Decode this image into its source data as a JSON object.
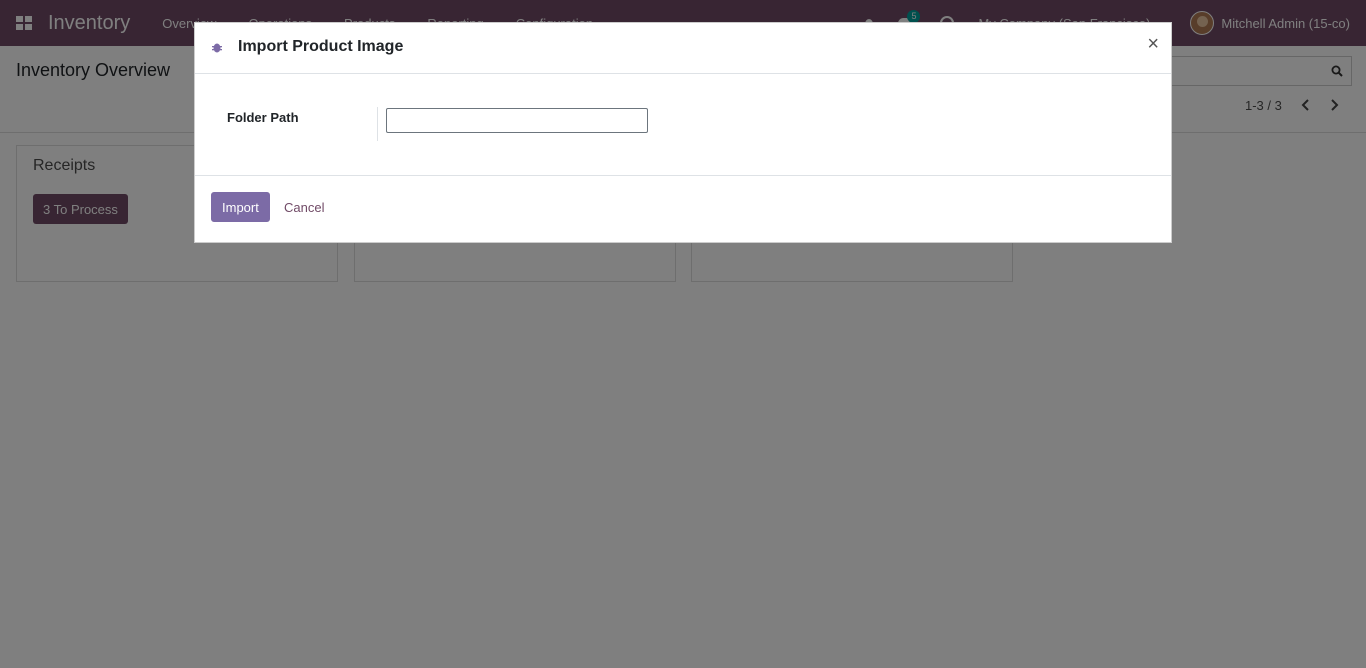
{
  "navbar": {
    "brand": "Inventory",
    "menu": [
      "Overview",
      "Operations",
      "Products",
      "Reporting",
      "Configuration"
    ],
    "chat_badge": "5",
    "company": "My Company (San Francisco)",
    "user": "Mitchell Admin (15-co)"
  },
  "control_panel": {
    "title": "Inventory Overview",
    "pager": "1-3 / 3"
  },
  "kanban": {
    "cards": [
      {
        "title": "Receipts",
        "button": "3 To Process"
      }
    ]
  },
  "modal": {
    "title": "Import Product Image",
    "field_label": "Folder Path",
    "field_value": "",
    "import_label": "Import",
    "cancel_label": "Cancel",
    "close_glyph": "×"
  },
  "colors": {
    "brand": "#714b67",
    "primary_button": "#7c6ba6",
    "badge": "#00a09d"
  }
}
